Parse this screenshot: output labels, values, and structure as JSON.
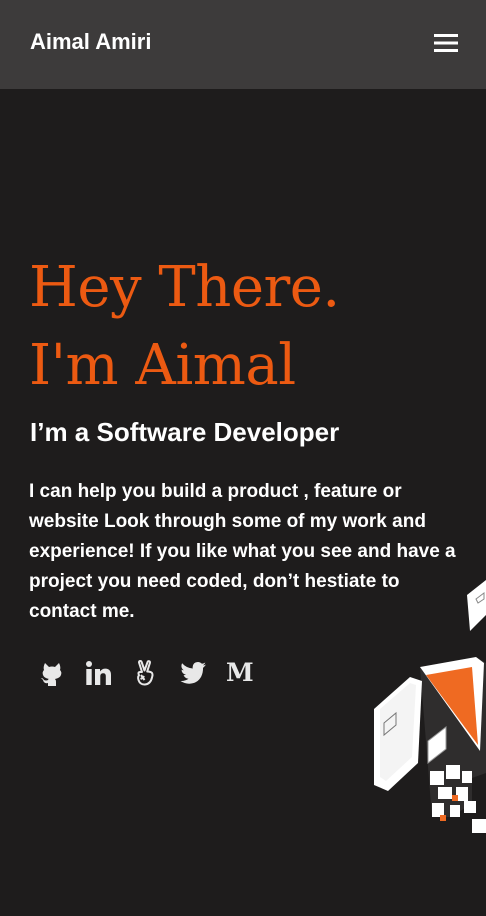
{
  "header": {
    "brand": "Aimal Amiri",
    "menu_icon": "hamburger-menu-icon"
  },
  "hero": {
    "greeting_line1": "Hey There.",
    "greeting_line2": "I'm Aimal",
    "role": "I’m a Software Developer",
    "intro": "I can help you build a product , feature or website Look through some of my work and experience! If you like what you see and have a project you need coded, don’t hestiate to contact me."
  },
  "social": [
    {
      "name": "github",
      "icon": "github-icon"
    },
    {
      "name": "linkedin",
      "icon": "linkedin-icon"
    },
    {
      "name": "angellist",
      "icon": "angellist-icon"
    },
    {
      "name": "twitter",
      "icon": "twitter-icon"
    },
    {
      "name": "medium",
      "icon": "medium-icon",
      "glyph": "M"
    }
  ],
  "colors": {
    "background": "#1e1c1c",
    "navbar": "#3d3b3b",
    "accent": "#ec5a12",
    "text": "#ffffff"
  }
}
